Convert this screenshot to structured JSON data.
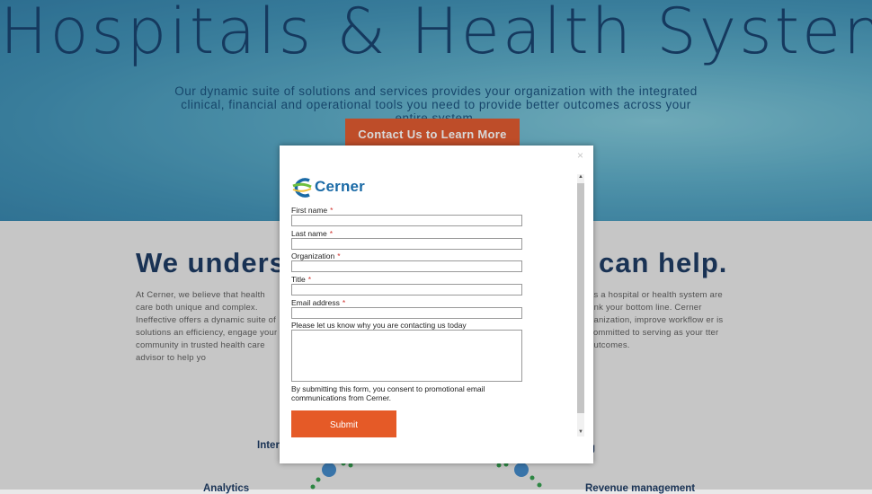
{
  "hero": {
    "title": "Hospitals & Health Systems",
    "subtitle": "Our dynamic suite of solutions and services provides your organization with the integrated clinical, financial and operational tools you need to provide better outcomes across your entire system.",
    "cta_label": "Contact Us to Learn More"
  },
  "section": {
    "heading_left": "We underst",
    "heading_right": "can help.",
    "para_left": "At Cerner, we believe that health care both unique and complex. Ineffective offers a dynamic suite of solutions an efficiency, engage your community in trusted health care advisor to help yo",
    "para_right": "as a hospital or health system are rink your bottom line. Cerner ganization, improve workflow er is committed to serving as your tter outcomes.",
    "categories": {
      "left_top": "Inter",
      "right_top": "ng",
      "left_bottom": "Analytics",
      "right_bottom": "Revenue management"
    }
  },
  "modal": {
    "close_glyph": "×",
    "logo_text": "Cerner",
    "fields": {
      "first_name": "First name",
      "last_name": "Last name",
      "organization": "Organization",
      "title": "Title",
      "email": "Email address"
    },
    "required_mark": "*",
    "message_label": "Please let us know why you are contacting us today",
    "consent": "By submitting this form, you consent to promotional email communications from Cerner.",
    "submit_label": "Submit"
  },
  "colors": {
    "accent_orange": "#e0562a",
    "navy": "#16355e",
    "logo_blue": "#1a6aa6",
    "logo_green": "#6fbf3f"
  },
  "icons": [
    "close-icon",
    "cerner-logo-icon",
    "scroll-up-icon",
    "scroll-down-icon"
  ]
}
